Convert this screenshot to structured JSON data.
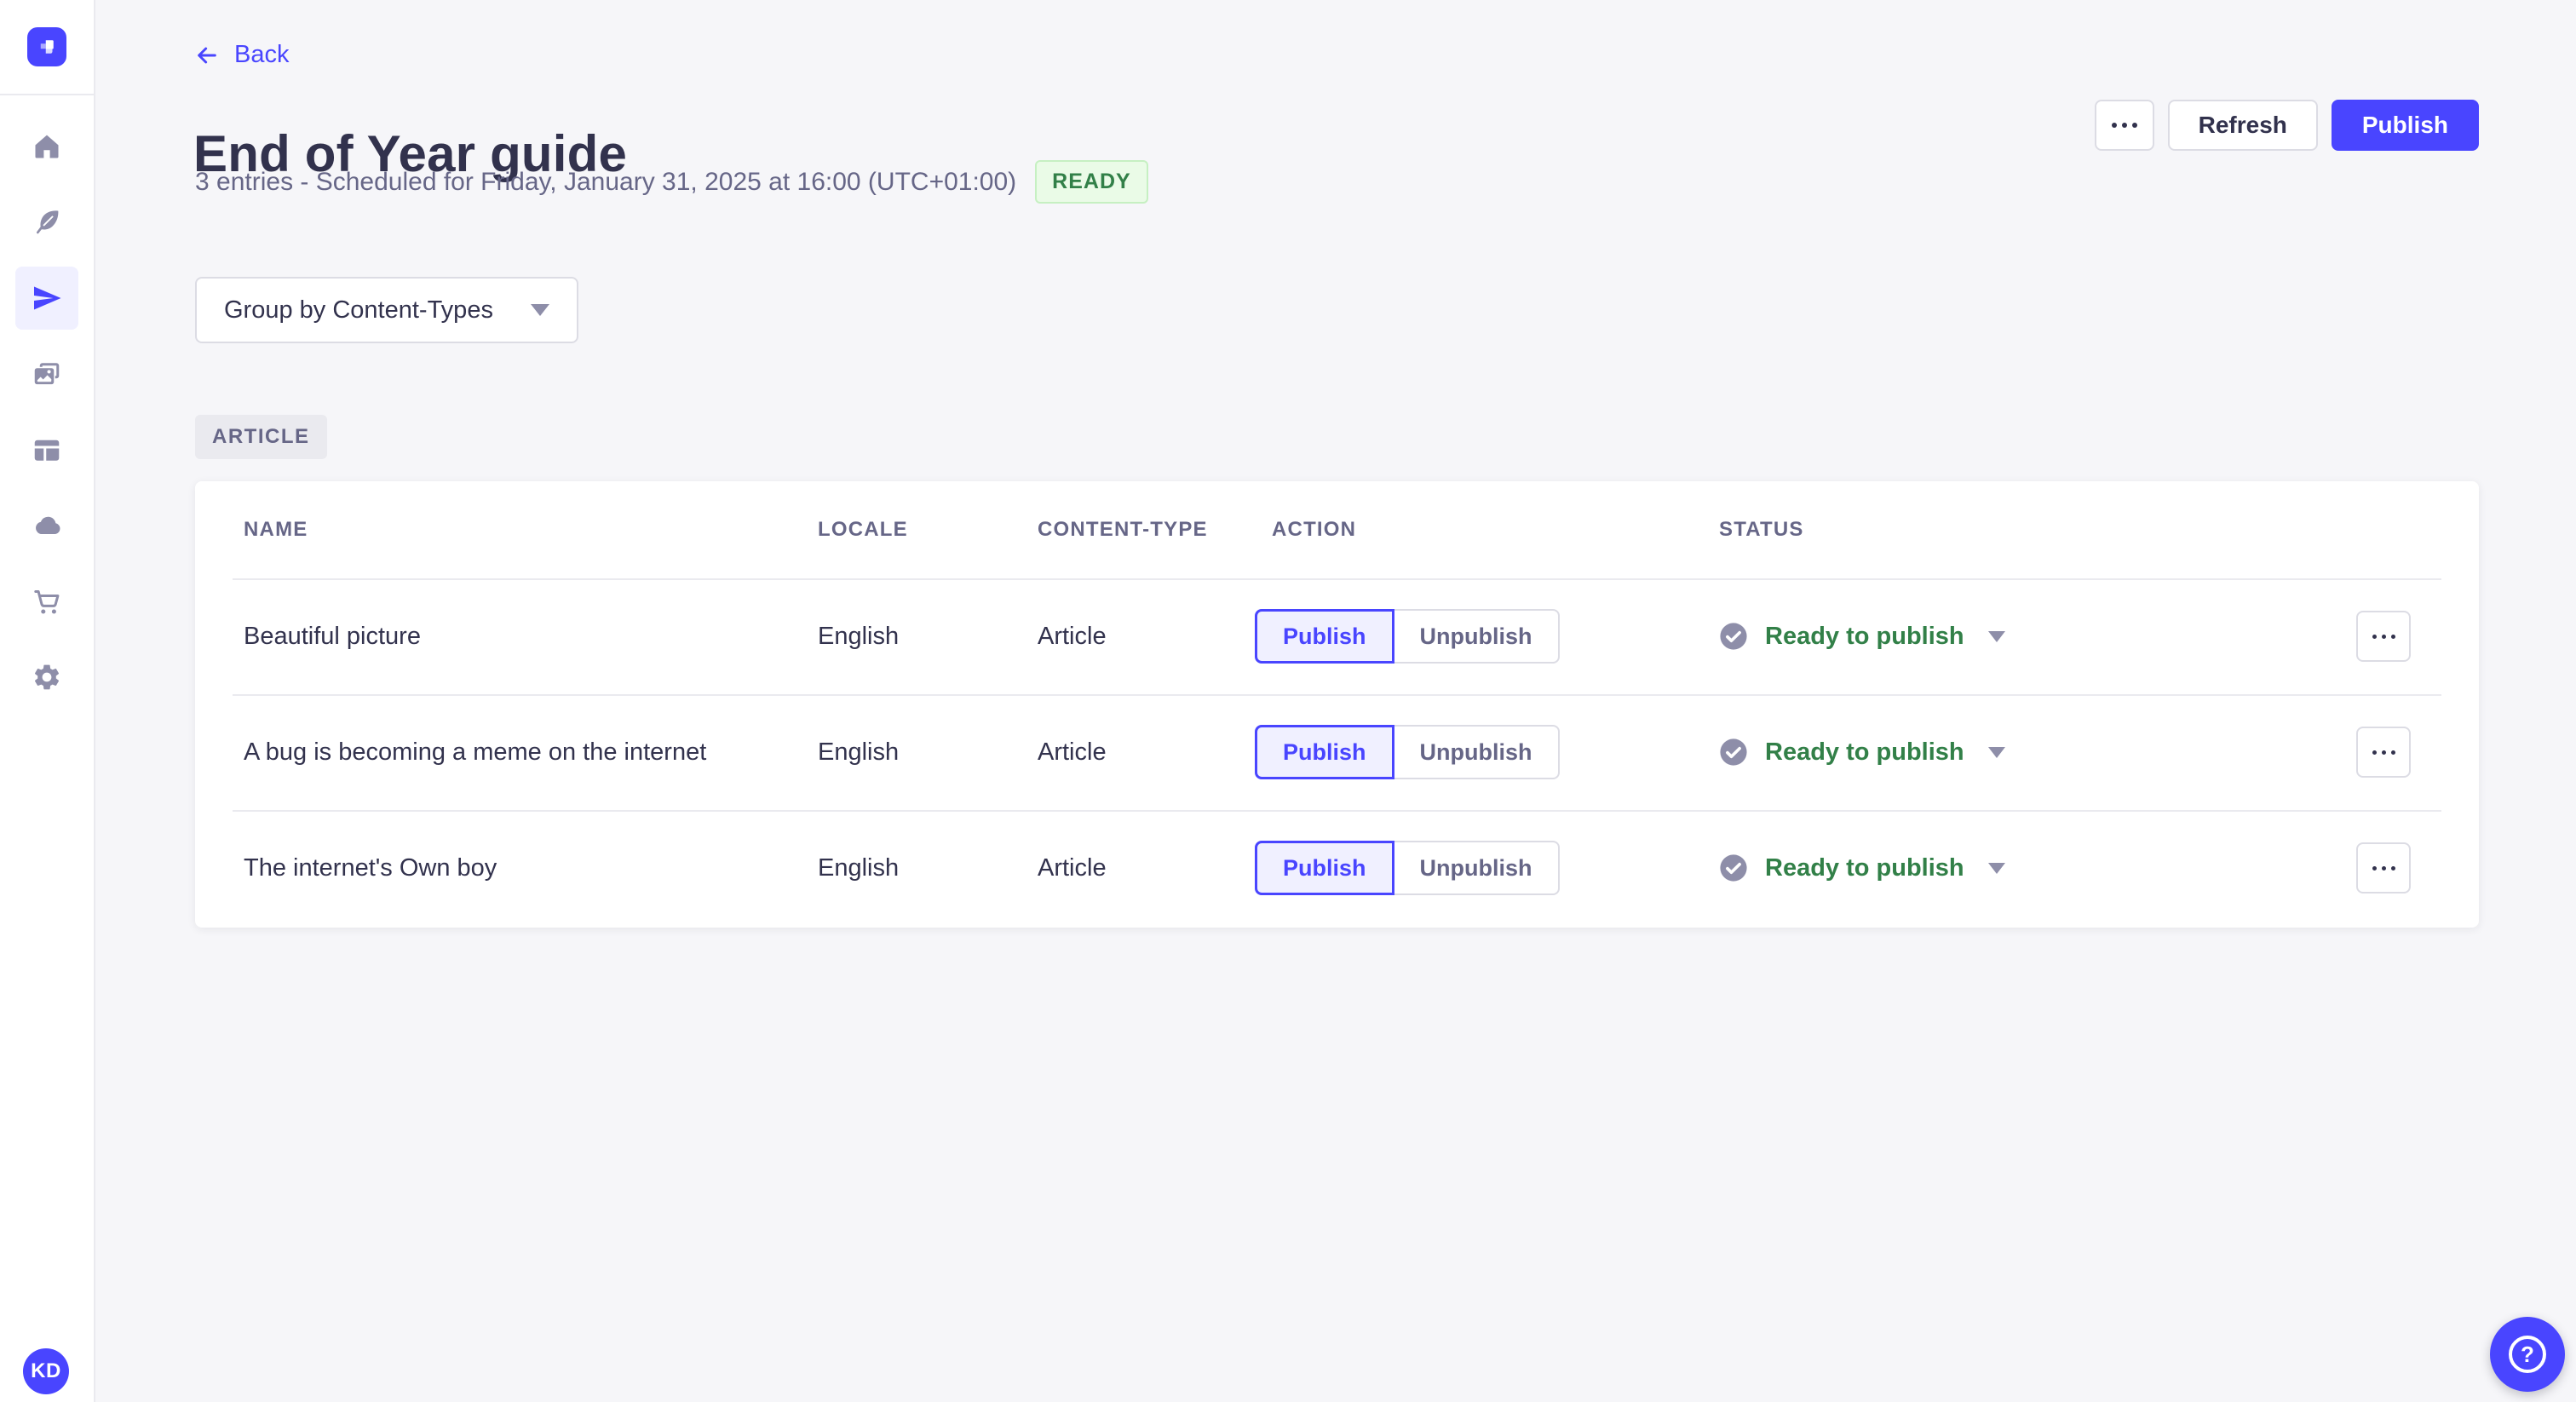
{
  "header": {
    "back": "Back",
    "title": "End of Year guide",
    "subtitle": "3 entries - Scheduled for Friday, January 31, 2025 at 16:00 (UTC+01:00)",
    "release_status": "READY",
    "refresh": "Refresh",
    "publish": "Publish"
  },
  "toolbar": {
    "group_by": "Group by Content-Types"
  },
  "content_group": {
    "label": "ARTICLE"
  },
  "table": {
    "columns": {
      "name": "NAME",
      "locale": "LOCALE",
      "content_type": "CONTENT-TYPE",
      "action": "ACTION",
      "status": "STATUS"
    },
    "actions": {
      "publish": "Publish",
      "unpublish": "Unpublish"
    },
    "rows": [
      {
        "name": "Beautiful picture",
        "locale": "English",
        "content_type": "Article",
        "status": "Ready to publish"
      },
      {
        "name": "A bug is becoming a meme on the internet",
        "locale": "English",
        "content_type": "Article",
        "status": "Ready to publish"
      },
      {
        "name": "The internet's Own boy",
        "locale": "English",
        "content_type": "Article",
        "status": "Ready to publish"
      }
    ]
  },
  "sidebar": {
    "icons": [
      "strapi-logo",
      "home",
      "content-manager-feather",
      "releases-paper-plane",
      "media-library-images",
      "content-type-builder-layout",
      "deploy-cloud",
      "marketplace-cart",
      "settings-gear"
    ],
    "active_item": "releases-paper-plane",
    "avatar_initials": "KD"
  },
  "help": {
    "icon": "question-mark"
  },
  "colors": {
    "primary": "#4945ff",
    "primary_light_bg": "#f0f0ff",
    "success_text": "#328048",
    "success_bg": "#eafbe7",
    "success_border": "#c6f0c2",
    "neutral_border": "#dcdce4",
    "divider": "#eaeaef",
    "page_bg": "#f6f6f9",
    "text": "#32324d",
    "text_secondary": "#666687",
    "icon_gray": "#8e8ea9"
  }
}
